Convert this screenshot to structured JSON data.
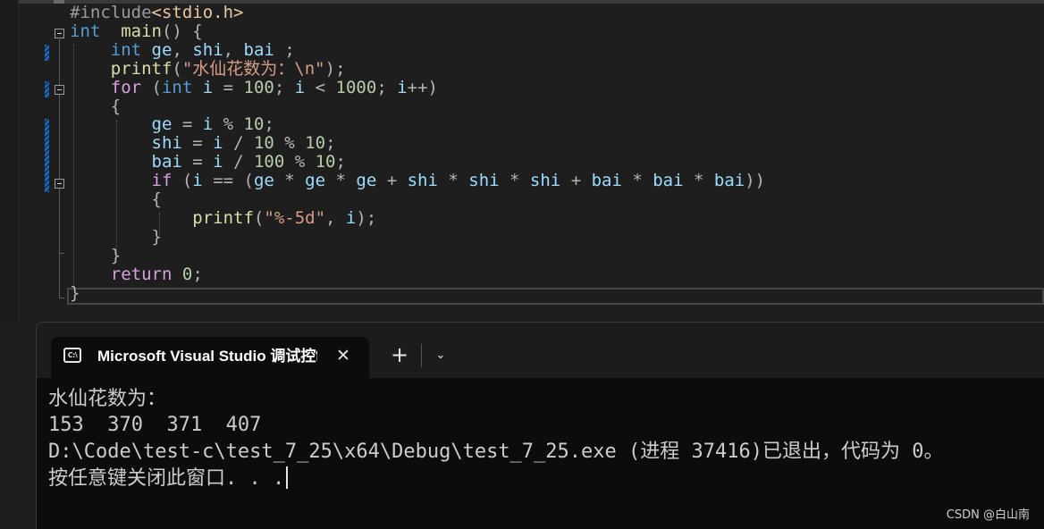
{
  "editor": {
    "lines": [
      [
        [
          "pre",
          "#include"
        ],
        [
          "inc",
          "<stdio.h>"
        ]
      ],
      [
        [
          "kw",
          "int"
        ],
        [
          "",
          "  "
        ],
        [
          "fn",
          "main"
        ],
        [
          "op",
          "() {"
        ]
      ],
      [
        [
          "",
          "    "
        ],
        [
          "kw",
          "int"
        ],
        [
          "",
          "",
          " "
        ],
        [
          "id",
          "ge"
        ],
        [
          "op",
          ", "
        ],
        [
          "id",
          "shi"
        ],
        [
          "op",
          ", "
        ],
        [
          "id",
          "bai"
        ],
        [
          "op",
          " ;"
        ]
      ],
      [
        [
          "",
          "    "
        ],
        [
          "fn",
          "printf"
        ],
        [
          "op",
          "("
        ],
        [
          "str",
          "\"水仙花数为：\\n\""
        ],
        [
          "op",
          ");"
        ]
      ],
      [
        [
          "",
          "    "
        ],
        [
          "kw2",
          "for"
        ],
        [
          "op",
          " ("
        ],
        [
          "kw",
          "int"
        ],
        [
          "op",
          " "
        ],
        [
          "id",
          "i"
        ],
        [
          "op",
          " = "
        ],
        [
          "num",
          "100"
        ],
        [
          "op",
          "; "
        ],
        [
          "id",
          "i"
        ],
        [
          "op",
          " < "
        ],
        [
          "num",
          "1000"
        ],
        [
          "op",
          "; "
        ],
        [
          "id",
          "i"
        ],
        [
          "op",
          "++)"
        ]
      ],
      [
        [
          "",
          "    "
        ],
        [
          "op",
          "{"
        ]
      ],
      [
        [
          "",
          "        "
        ],
        [
          "id",
          "ge"
        ],
        [
          "op",
          " = "
        ],
        [
          "id",
          "i"
        ],
        [
          "op",
          " % "
        ],
        [
          "num",
          "10"
        ],
        [
          "op",
          ";"
        ]
      ],
      [
        [
          "",
          "        "
        ],
        [
          "id",
          "shi"
        ],
        [
          "op",
          " = "
        ],
        [
          "id",
          "i"
        ],
        [
          "op",
          " / "
        ],
        [
          "num",
          "10"
        ],
        [
          "op",
          " % "
        ],
        [
          "num",
          "10"
        ],
        [
          "op",
          ";"
        ]
      ],
      [
        [
          "",
          "        "
        ],
        [
          "id",
          "bai"
        ],
        [
          "op",
          " = "
        ],
        [
          "id",
          "i"
        ],
        [
          "op",
          " / "
        ],
        [
          "num",
          "100"
        ],
        [
          "op",
          " % "
        ],
        [
          "num",
          "10"
        ],
        [
          "op",
          ";"
        ]
      ],
      [
        [
          "",
          "        "
        ],
        [
          "kw2",
          "if"
        ],
        [
          "op",
          " ("
        ],
        [
          "id",
          "i"
        ],
        [
          "op",
          " == ("
        ],
        [
          "id",
          "ge"
        ],
        [
          "op",
          " * "
        ],
        [
          "id",
          "ge"
        ],
        [
          "op",
          " * "
        ],
        [
          "id",
          "ge"
        ],
        [
          "op",
          " + "
        ],
        [
          "id",
          "shi"
        ],
        [
          "op",
          " * "
        ],
        [
          "id",
          "shi"
        ],
        [
          "op",
          " * "
        ],
        [
          "id",
          "shi"
        ],
        [
          "op",
          " + "
        ],
        [
          "id",
          "bai"
        ],
        [
          "op",
          " * "
        ],
        [
          "id",
          "bai"
        ],
        [
          "op",
          " * "
        ],
        [
          "id",
          "bai"
        ],
        [
          "op",
          "))"
        ]
      ],
      [
        [
          "",
          "        "
        ],
        [
          "op",
          "{"
        ]
      ],
      [
        [
          "",
          "            "
        ],
        [
          "fn",
          "printf"
        ],
        [
          "op",
          "("
        ],
        [
          "str",
          "\"%-5d\""
        ],
        [
          "op",
          ", "
        ],
        [
          "id",
          "i"
        ],
        [
          "op",
          ");"
        ]
      ],
      [
        [
          "",
          "        "
        ],
        [
          "op",
          "}"
        ]
      ],
      [
        [
          "",
          "    "
        ],
        [
          "op",
          "}"
        ]
      ],
      [
        [
          "",
          "    "
        ],
        [
          "kw2",
          "return"
        ],
        [
          "op",
          " "
        ],
        [
          "num",
          "0"
        ],
        [
          "op",
          ";"
        ]
      ],
      [
        [
          "op",
          "}"
        ]
      ]
    ]
  },
  "terminal": {
    "tab_icon_text": "C:\\",
    "tab_title": "Microsoft Visual Studio 调试控制台",
    "close_glyph": "✕",
    "new_tab_glyph": "+",
    "dropdown_glyph": "⌄",
    "output_lines": [
      "水仙花数为：",
      "153  370  371  407",
      "D:\\Code\\test-c\\test_7_25\\x64\\Debug\\test_7_25.exe (进程 37416)已退出，代码为 0。",
      "按任意键关闭此窗口. . ."
    ]
  },
  "watermark": "CSDN @白山南",
  "colors": {
    "keyword": "#569cd6",
    "control_keyword": "#d8a0df",
    "function": "#dcdcaa",
    "identifier": "#9cdcfe",
    "number": "#b5cea8",
    "string": "#d69d85",
    "change_marker": "#1f6fc5"
  }
}
